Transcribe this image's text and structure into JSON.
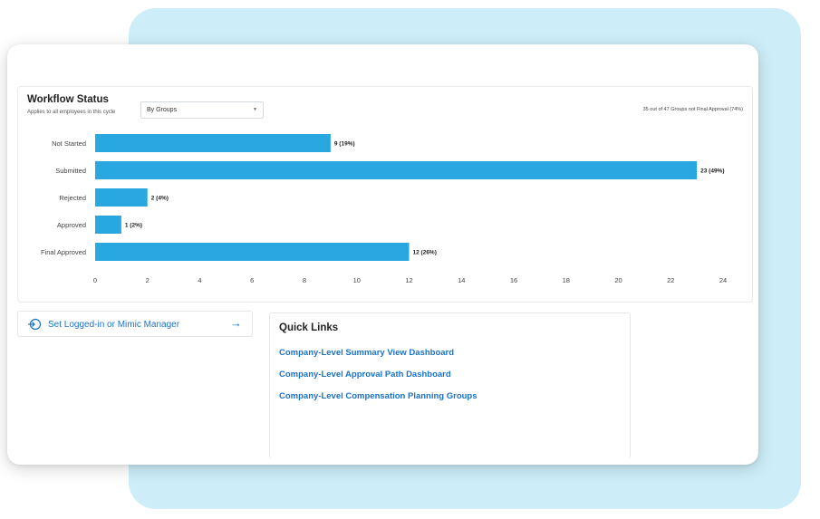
{
  "workflow": {
    "title": "Workflow Status",
    "subtitle": "Applies to all employees in this cycle",
    "group_select": "By Groups",
    "summary": "35 out of 47 Groups not Final Approval (74%)"
  },
  "chart_data": {
    "type": "bar",
    "orientation": "horizontal",
    "categories": [
      "Not Started",
      "Submitted",
      "Rejected",
      "Approved",
      "Final Approved"
    ],
    "values": [
      9,
      23,
      2,
      1,
      12
    ],
    "data_labels": [
      "9 (19%)",
      "23 (49%)",
      "2 (4%)",
      "1 (2%)",
      "12 (26%)"
    ],
    "xticks": [
      0,
      2,
      4,
      6,
      8,
      10,
      12,
      14,
      16,
      18,
      20,
      22,
      24
    ],
    "xlim": [
      0,
      24
    ],
    "grid": false,
    "bar_color": "#29a8e0"
  },
  "mimic": {
    "label": "Set Logged-in or Mimic Manager",
    "icon": "login-icon",
    "arrow_icon": "arrow-right-icon"
  },
  "quick_links": {
    "title": "Quick Links",
    "links": [
      "Company-Level Summary View Dashboard",
      "Company-Level Approval Path Dashboard",
      "Company-Level Compensation Planning Groups"
    ]
  },
  "colors": {
    "accent": "#1a73c8",
    "background_panel": "#cdeef9"
  }
}
